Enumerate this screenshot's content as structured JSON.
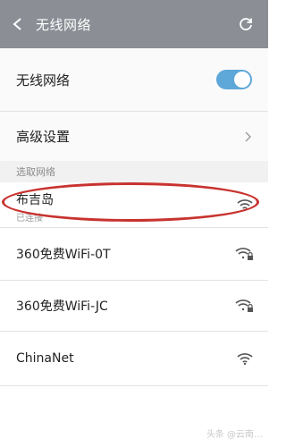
{
  "header": {
    "title": "无线网络",
    "back_icon": "back-arrow-icon",
    "refresh_icon": "refresh-icon"
  },
  "settings": {
    "wifi_label": "无线网络",
    "wifi_enabled": true,
    "advanced_label": "高级设置"
  },
  "section_label": "选取网络",
  "networks": [
    {
      "name": "布吉岛",
      "status": "已连接",
      "locked": false
    },
    {
      "name": "360免费WiFi-0T",
      "status": "",
      "locked": true
    },
    {
      "name": "360免费WiFi-JC",
      "status": "",
      "locked": true
    },
    {
      "name": "ChinaNet",
      "status": "",
      "locked": false
    }
  ],
  "watermark": "头条 @云南…",
  "colors": {
    "header": "#8b8e95",
    "toggle_on": "#5ea7d9",
    "highlight": "#c8332f"
  }
}
